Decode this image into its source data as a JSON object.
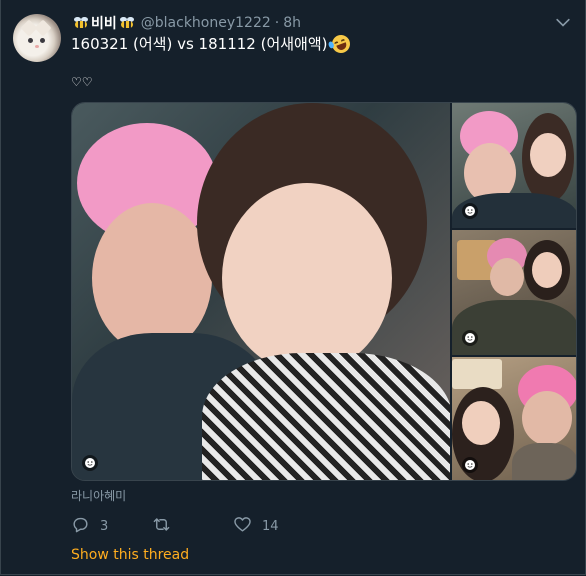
{
  "tweet": {
    "display_name": "비비",
    "handle": "@blackhoney1222",
    "separator": "·",
    "time": "8h",
    "text": "160321 (어색) vs 181112 (어새애액)",
    "hearts": "♡♡",
    "tagged_people": "라니아혜미",
    "reply_count": "3",
    "like_count": "14",
    "show_thread_label": "Show this thread"
  },
  "icons": {
    "avatar": "cat-avatar",
    "display_name_decoration": "bee-emoji",
    "text_emoji": "rolling-on-floor-laughing-emoji",
    "menu": "chevron-down-icon",
    "media_badge": "smiley-icon",
    "reply": "reply-icon",
    "retweet": "retweet-icon",
    "like": "heart-icon"
  },
  "colors": {
    "background": "#15202b",
    "secondary_text": "#8899a6",
    "link_accent": "#ffad1f",
    "border": "#38444d"
  }
}
